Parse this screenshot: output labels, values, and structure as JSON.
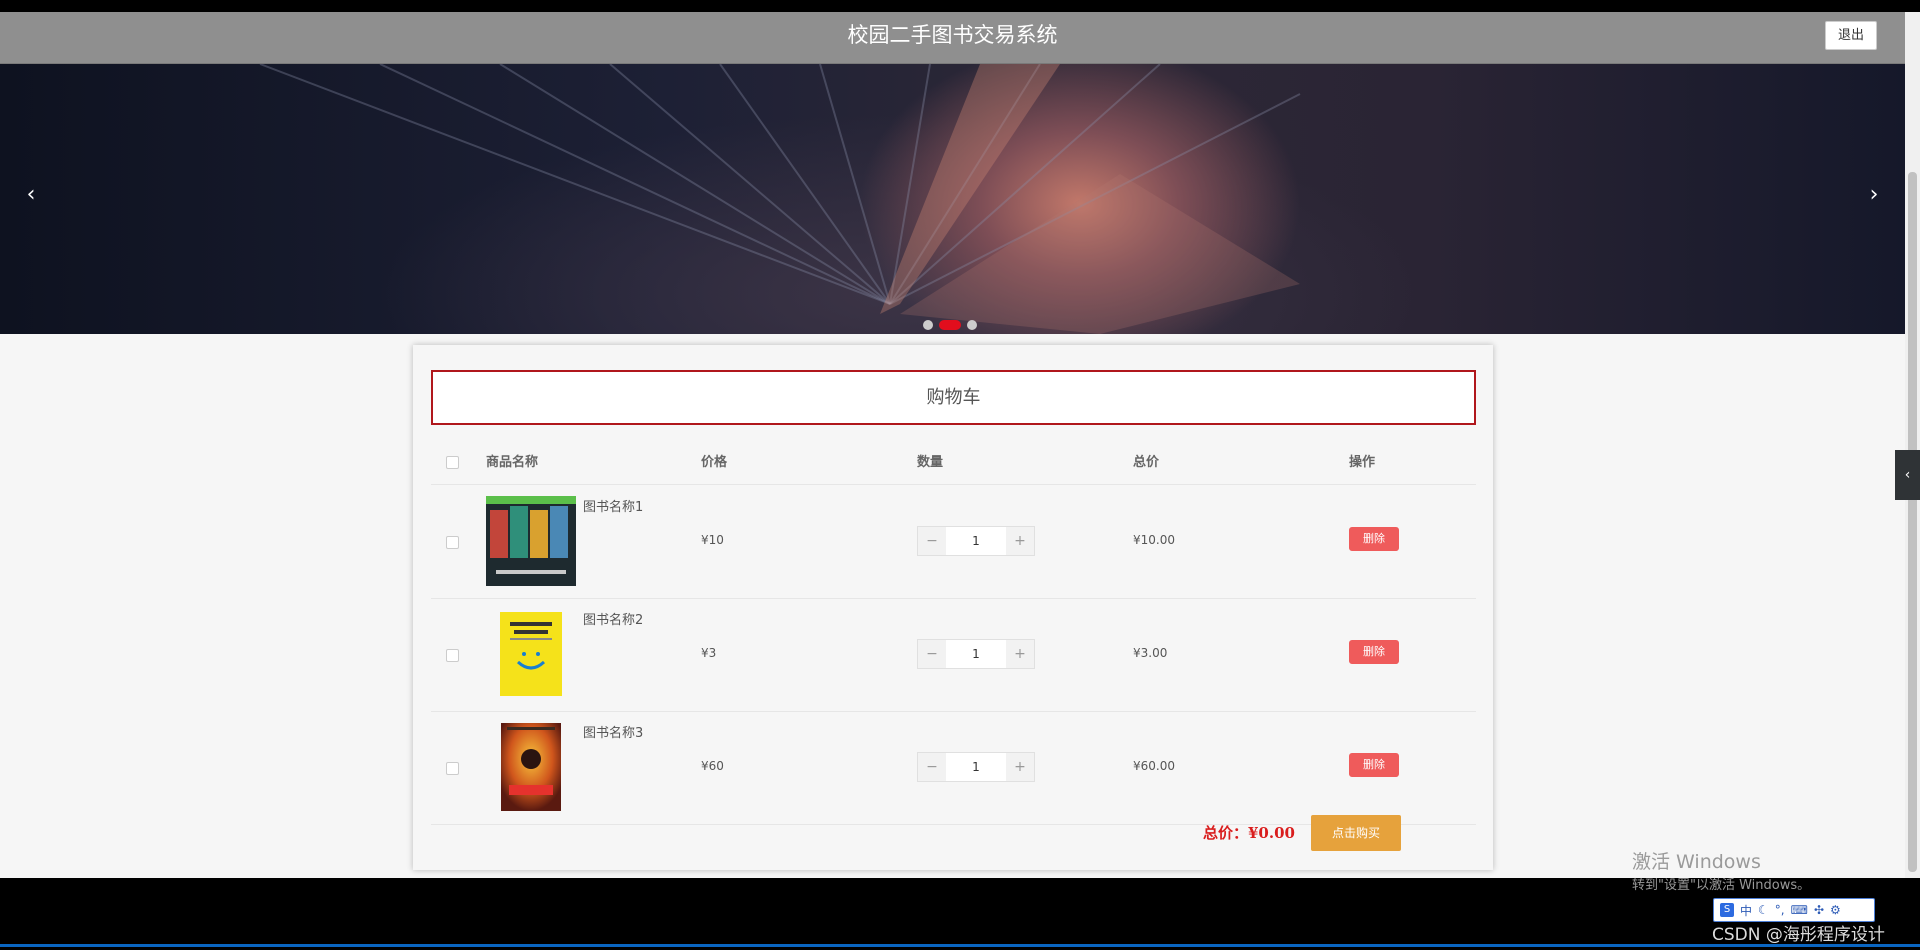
{
  "app": {
    "title": "校园二手图书交易系统",
    "logout_label": "退出"
  },
  "banner": {
    "prev_icon": "‹",
    "next_icon": "›",
    "slide_count": 3,
    "active_slide": 2
  },
  "cart": {
    "title": "购物车",
    "columns": [
      "商品名称",
      "价格",
      "数量",
      "总价",
      "操作"
    ],
    "items": [
      {
        "name": "图书名称1",
        "price": "¥10",
        "qty": "1",
        "total": "¥10.00",
        "delete_label": "删除",
        "decrement": "−",
        "increment": "+"
      },
      {
        "name": "图书名称2",
        "price": "¥3",
        "qty": "1",
        "total": "¥3.00",
        "delete_label": "删除",
        "decrement": "−",
        "increment": "+"
      },
      {
        "name": "图书名称3",
        "price": "¥60",
        "qty": "1",
        "total": "¥60.00",
        "delete_label": "删除",
        "decrement": "−",
        "increment": "+"
      }
    ],
    "grand_total": "总价：¥0.00",
    "buy_label": "点击购买"
  },
  "side_tab_icon": "‹",
  "os": {
    "activate_title": "激活 Windows",
    "activate_sub": "转到\"设置\"以激活 Windows。",
    "ime_lang": "中",
    "watermark": "CSDN @海彤程序设计"
  },
  "colors": {
    "header_bg": "#8f8f8f",
    "accent_red": "#b0171c",
    "delete_btn": "#ef5b5b",
    "buy_btn": "#e6a23c",
    "total_text": "#d91d1d"
  }
}
